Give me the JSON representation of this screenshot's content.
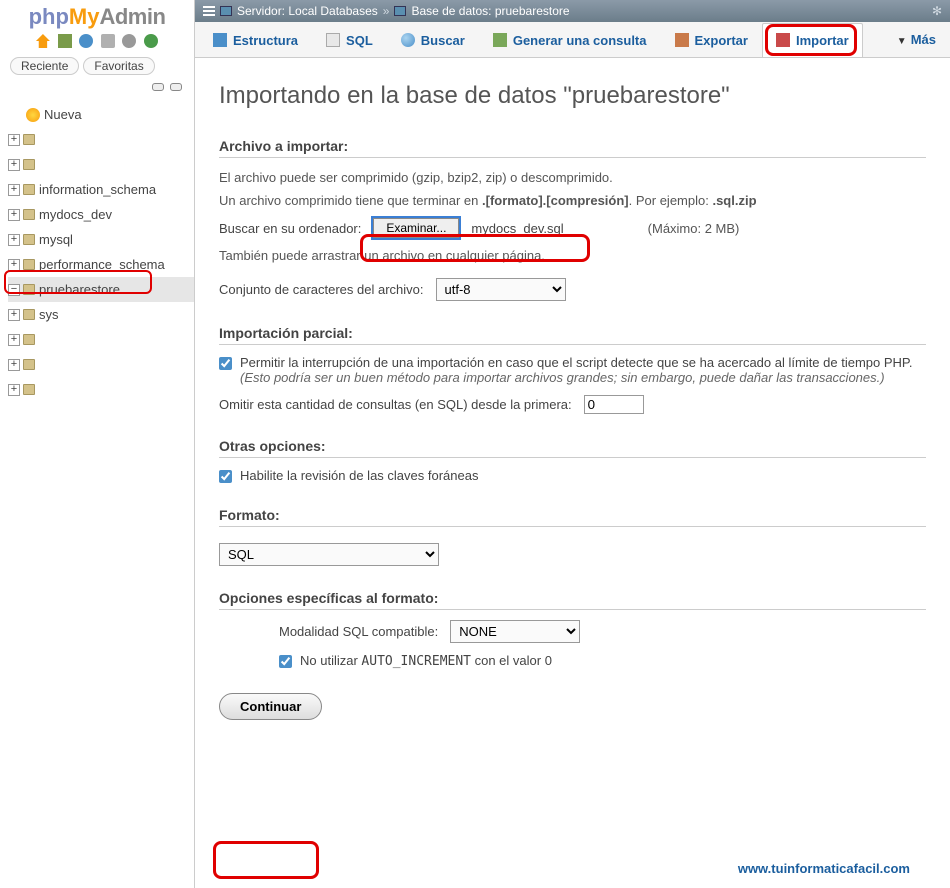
{
  "logo": {
    "php": "php",
    "my": "My",
    "admin": "Admin"
  },
  "sidebar": {
    "tabs": {
      "recent": "Reciente",
      "favorites": "Favoritas"
    },
    "new_label": "Nueva",
    "dbs": [
      "information_schema",
      "mydocs_dev",
      "mysql",
      "performance_schema",
      "pruebarestore",
      "sys"
    ]
  },
  "breadcrumb": {
    "server_label": "Servidor: Local Databases",
    "sep": "»",
    "db_label": "Base de datos: pruebarestore"
  },
  "tabs": {
    "structure": "Estructura",
    "sql": "SQL",
    "search": "Buscar",
    "query": "Generar una consulta",
    "export": "Exportar",
    "import": "Importar",
    "more": "Más"
  },
  "heading": "Importando en la base de datos \"pruebarestore\"",
  "import_file": {
    "legend": "Archivo a importar:",
    "desc1": "El archivo puede ser comprimido (gzip, bzip2, zip) o descomprimido.",
    "desc2a": "Un archivo comprimido tiene que terminar en ",
    "desc2b": ".[formato].[compresión]",
    "desc2c": ". Por ejemplo: ",
    "desc2d": ".sql.zip",
    "browse_label": "Buscar en su ordenador:",
    "browse_btn": "Examinar...",
    "filename": "mydocs_dev.sql",
    "max_label": "(Máximo: 2 MB)",
    "drag_hint": "También puede arrastrar un archivo en cualquier página.",
    "charset_label": "Conjunto de caracteres del archivo:",
    "charset_value": "utf-8"
  },
  "partial": {
    "legend": "Importación parcial:",
    "allow_interrupt": "Permitir la interrupción de una importación en caso que el script detecte que se ha acercado al límite de tiempo PHP. ",
    "hint": "(Esto podría ser un buen método para importar archivos grandes; sin embargo, puede dañar las transacciones.)",
    "skip_label": "Omitir esta cantidad de consultas (en SQL) desde la primera:",
    "skip_value": "0"
  },
  "other": {
    "legend": "Otras opciones:",
    "fk_label": "Habilite la revisión de las claves foráneas"
  },
  "format": {
    "legend": "Formato:",
    "value": "SQL"
  },
  "format_opts": {
    "legend": "Opciones específicas al formato:",
    "compat_label": "Modalidad SQL compatible:",
    "compat_value": "NONE",
    "noauto_a": "No utilizar ",
    "noauto_b": "AUTO_INCREMENT",
    "noauto_c": " con el valor 0"
  },
  "continue_btn": "Continuar",
  "footer_url": "www.tuinformaticafacil.com"
}
